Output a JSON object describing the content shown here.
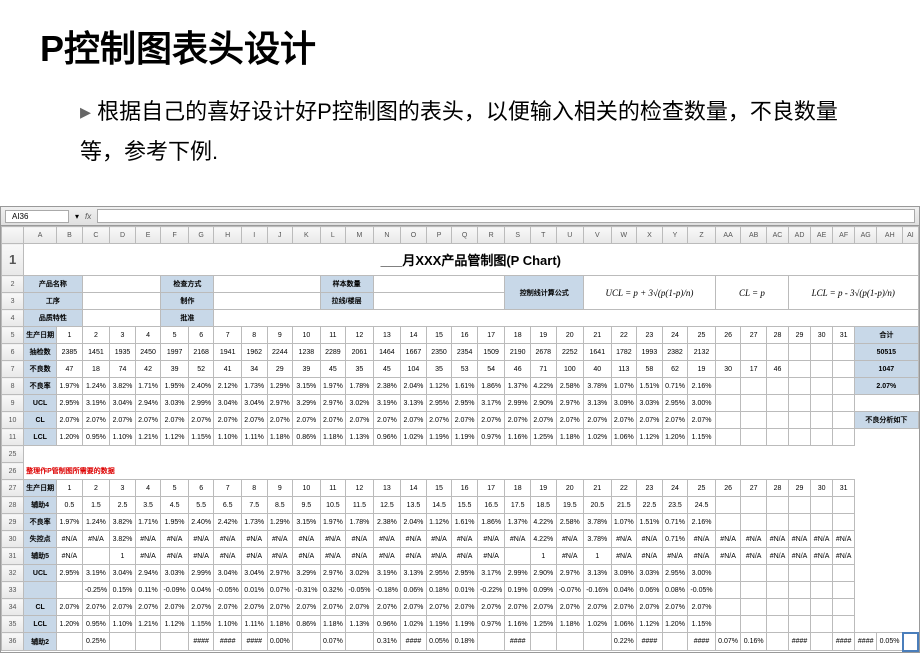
{
  "title": "P控制图表头设计",
  "bullet": "根据自己的喜好设计好P控制图的表头，以便输入相关的检查数量，不良数量等，参考下例.",
  "cellref": "AI36",
  "chart_title": "___月XXX产品管制图(P Chart)",
  "columns": [
    "",
    "A",
    "B",
    "C",
    "D",
    "E",
    "F",
    "G",
    "H",
    "I",
    "J",
    "K",
    "L",
    "M",
    "N",
    "O",
    "P",
    "Q",
    "R",
    "S",
    "T",
    "U",
    "V",
    "W",
    "X",
    "Y",
    "Z",
    "AA",
    "AB",
    "AC",
    "AD",
    "AE",
    "AF",
    "AG",
    "AH",
    "AI"
  ],
  "header_labels": {
    "product": "产品名称",
    "check": "检查方式",
    "sample": "样本数量",
    "formula_hdr": "控制线计算公式",
    "process": "工序",
    "make": "制作",
    "drawline": "拉线/楼层",
    "quality": "品质特性",
    "approve": "批准"
  },
  "formulas": {
    "ucl": "UCL = p + 3√(p(1-p)/n)",
    "cl": "CL = p",
    "lcl": "LCL = p - 3√(p(1-p)/n)"
  },
  "row_labels": {
    "date": "生产日期",
    "check_qty": "抽检数",
    "defect_qty": "不良数",
    "defect_rate": "不良率",
    "ucl": "UCL",
    "cl": "CL",
    "lcl": "LCL",
    "total": "合计",
    "analysis": "不良分析如下",
    "aux4": "辅助4",
    "missing": "失控点",
    "aux5": "辅助5",
    "aux2": "辅助2",
    "section2": "整理作P管制图所需要的数据"
  },
  "days": [
    "1",
    "2",
    "3",
    "4",
    "5",
    "6",
    "7",
    "8",
    "9",
    "10",
    "11",
    "12",
    "13",
    "14",
    "15",
    "16",
    "17",
    "18",
    "19",
    "20",
    "21",
    "22",
    "23",
    "24",
    "25",
    "26",
    "27",
    "28",
    "29",
    "30",
    "31"
  ],
  "data_top": {
    "check_qty": [
      "2385",
      "1451",
      "1935",
      "2450",
      "1997",
      "2168",
      "1941",
      "1962",
      "2244",
      "1238",
      "2289",
      "2061",
      "1464",
      "1667",
      "2350",
      "2354",
      "1509",
      "2190",
      "2678",
      "2252",
      "1641",
      "1782",
      "1993",
      "2382",
      "2132"
    ],
    "defect_qty": [
      "47",
      "18",
      "74",
      "42",
      "39",
      "52",
      "41",
      "34",
      "29",
      "39",
      "45",
      "35",
      "45",
      "104",
      "35",
      "53",
      "54",
      "46",
      "71",
      "100",
      "40",
      "113",
      "58",
      "62",
      "19",
      "30",
      "17",
      "46"
    ],
    "defect_rate": [
      "1.97%",
      "1.24%",
      "3.82%",
      "1.71%",
      "1.95%",
      "2.40%",
      "2.12%",
      "1.73%",
      "1.29%",
      "3.15%",
      "1.97%",
      "1.78%",
      "2.38%",
      "2.04%",
      "1.12%",
      "1.61%",
      "1.86%",
      "1.37%",
      "4.22%",
      "2.58%",
      "3.78%",
      "1.07%",
      "1.51%",
      "0.71%",
      "2.16%"
    ],
    "ucl": [
      "2.95%",
      "3.19%",
      "3.04%",
      "2.94%",
      "3.03%",
      "2.99%",
      "3.04%",
      "3.04%",
      "2.97%",
      "3.29%",
      "2.97%",
      "3.02%",
      "3.19%",
      "3.13%",
      "2.95%",
      "2.95%",
      "3.17%",
      "2.99%",
      "2.90%",
      "2.97%",
      "3.13%",
      "3.09%",
      "3.03%",
      "2.95%",
      "3.00%"
    ],
    "cl": [
      "2.07%",
      "2.07%",
      "2.07%",
      "2.07%",
      "2.07%",
      "2.07%",
      "2.07%",
      "2.07%",
      "2.07%",
      "2.07%",
      "2.07%",
      "2.07%",
      "2.07%",
      "2.07%",
      "2.07%",
      "2.07%",
      "2.07%",
      "2.07%",
      "2.07%",
      "2.07%",
      "2.07%",
      "2.07%",
      "2.07%",
      "2.07%",
      "2.07%"
    ],
    "lcl": [
      "1.20%",
      "0.95%",
      "1.10%",
      "1.21%",
      "1.12%",
      "1.15%",
      "1.10%",
      "1.11%",
      "1.18%",
      "0.86%",
      "1.18%",
      "1.13%",
      "0.96%",
      "1.02%",
      "1.19%",
      "1.19%",
      "0.97%",
      "1.16%",
      "1.25%",
      "1.18%",
      "1.02%",
      "1.06%",
      "1.12%",
      "1.20%",
      "1.15%"
    ]
  },
  "totals": {
    "check_qty": "50515",
    "defect_qty": "1047",
    "defect_rate": "2.07%"
  },
  "data_bottom": {
    "aux4": [
      "0.5",
      "1.5",
      "2.5",
      "3.5",
      "4.5",
      "5.5",
      "6.5",
      "7.5",
      "8.5",
      "9.5",
      "10.5",
      "11.5",
      "12.5",
      "13.5",
      "14.5",
      "15.5",
      "16.5",
      "17.5",
      "18.5",
      "19.5",
      "20.5",
      "21.5",
      "22.5",
      "23.5",
      "24.5"
    ],
    "defect_rate": [
      "1.97%",
      "1.24%",
      "3.82%",
      "1.71%",
      "1.95%",
      "2.40%",
      "2.42%",
      "1.73%",
      "1.29%",
      "3.15%",
      "1.97%",
      "1.78%",
      "2.38%",
      "2.04%",
      "1.12%",
      "1.61%",
      "1.86%",
      "1.37%",
      "4.22%",
      "2.58%",
      "3.78%",
      "1.07%",
      "1.51%",
      "0.71%",
      "2.16%"
    ],
    "missing": [
      "#N/A",
      "#N/A",
      "3.82%",
      "#N/A",
      "#N/A",
      "#N/A",
      "#N/A",
      "#N/A",
      "#N/A",
      "#N/A",
      "#N/A",
      "#N/A",
      "#N/A",
      "#N/A",
      "#N/A",
      "#N/A",
      "#N/A",
      "#N/A",
      "4.22%",
      "#N/A",
      "3.78%",
      "#N/A",
      "#N/A",
      "0.71%",
      "#N/A",
      "#N/A",
      "#N/A",
      "#N/A",
      "#N/A",
      "#N/A",
      "#N/A"
    ],
    "aux5": [
      "#N/A",
      "",
      "1",
      "#N/A",
      "#N/A",
      "#N/A",
      "#N/A",
      "#N/A",
      "#N/A",
      "#N/A",
      "#N/A",
      "#N/A",
      "#N/A",
      "#N/A",
      "#N/A",
      "#N/A",
      "#N/A",
      "",
      "1",
      "#N/A",
      "1",
      "#N/A",
      "#N/A",
      "#N/A",
      "#N/A",
      "#N/A",
      "#N/A",
      "#N/A",
      "#N/A",
      "#N/A",
      "#N/A"
    ],
    "ucl": [
      "2.95%",
      "3.19%",
      "3.04%",
      "2.94%",
      "3.03%",
      "2.99%",
      "3.04%",
      "3.04%",
      "2.97%",
      "3.29%",
      "2.97%",
      "3.02%",
      "3.19%",
      "3.13%",
      "2.95%",
      "2.95%",
      "3.17%",
      "2.99%",
      "2.90%",
      "2.97%",
      "3.13%",
      "3.09%",
      "3.03%",
      "2.95%",
      "3.00%"
    ],
    "ucl2": [
      "",
      "-0.25%",
      "0.15%",
      "0.11%",
      "-0.09%",
      "0.04%",
      "-0.05%",
      "0.01%",
      "0.07%",
      "-0.31%",
      "0.32%",
      "-0.05%",
      "-0.18%",
      "0.06%",
      "0.18%",
      "0.01%",
      "-0.22%",
      "0.19%",
      "0.09%",
      "-0.07%",
      "-0.16%",
      "0.04%",
      "0.06%",
      "0.08%",
      "-0.05%"
    ],
    "cl": [
      "2.07%",
      "2.07%",
      "2.07%",
      "2.07%",
      "2.07%",
      "2.07%",
      "2.07%",
      "2.07%",
      "2.07%",
      "2.07%",
      "2.07%",
      "2.07%",
      "2.07%",
      "2.07%",
      "2.07%",
      "2.07%",
      "2.07%",
      "2.07%",
      "2.07%",
      "2.07%",
      "2.07%",
      "2.07%",
      "2.07%",
      "2.07%",
      "2.07%"
    ],
    "lcl": [
      "1.20%",
      "0.95%",
      "1.10%",
      "1.21%",
      "1.12%",
      "1.15%",
      "1.10%",
      "1.11%",
      "1.18%",
      "0.86%",
      "1.18%",
      "1.13%",
      "0.96%",
      "1.02%",
      "1.19%",
      "1.19%",
      "0.97%",
      "1.16%",
      "1.25%",
      "1.18%",
      "1.02%",
      "1.06%",
      "1.12%",
      "1.20%",
      "1.15%"
    ],
    "aux2": [
      "",
      "0.25%",
      "",
      "",
      "",
      "####",
      "####",
      "####",
      "0.00%",
      "",
      "0.07%",
      "",
      "0.31%",
      "####",
      "0.05%",
      "0.18%",
      "",
      "####",
      "",
      "",
      "",
      "0.22%",
      "####",
      "",
      "####",
      "0.07%",
      "0.16%",
      "",
      "####",
      "",
      "####",
      "####",
      "0.05%"
    ]
  }
}
